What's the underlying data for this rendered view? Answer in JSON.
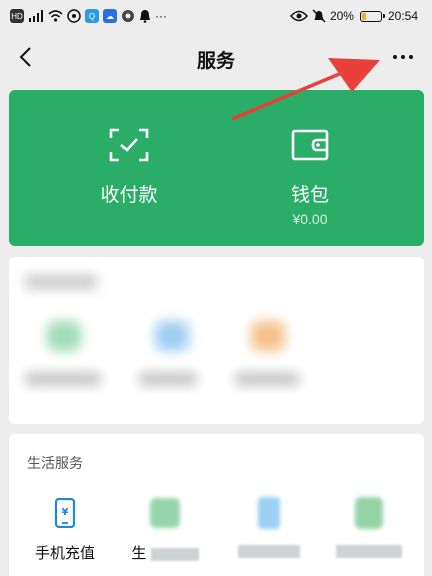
{
  "status_bar": {
    "left_icons": [
      "hd-icon",
      "signal-icon",
      "wifi-icon",
      "app-icon",
      "search-app-icon",
      "cloud-app-icon",
      "app-icon-2",
      "bell-icon"
    ],
    "ellipsis": "···",
    "battery_percent": "20%",
    "battery_level": 0.2,
    "time": "20:54"
  },
  "header": {
    "title": "服务"
  },
  "pay_card": {
    "color": "#2aae67",
    "items": [
      {
        "label": "收付款",
        "icon": "scan-pay-icon"
      },
      {
        "label": "钱包",
        "sub": "¥0.00",
        "icon": "wallet-icon"
      }
    ]
  },
  "life_services": {
    "title": "生活服务",
    "items": [
      {
        "label": "手机充值",
        "icon": "phone-recharge-icon"
      },
      {
        "label": "生",
        "icon": "life-payment-icon"
      },
      {
        "label": "",
        "icon": "blurred-service-icon"
      },
      {
        "label": "",
        "icon": "blurred-service-icon"
      }
    ]
  },
  "annotation": {
    "arrow_color": "#e8403a"
  }
}
